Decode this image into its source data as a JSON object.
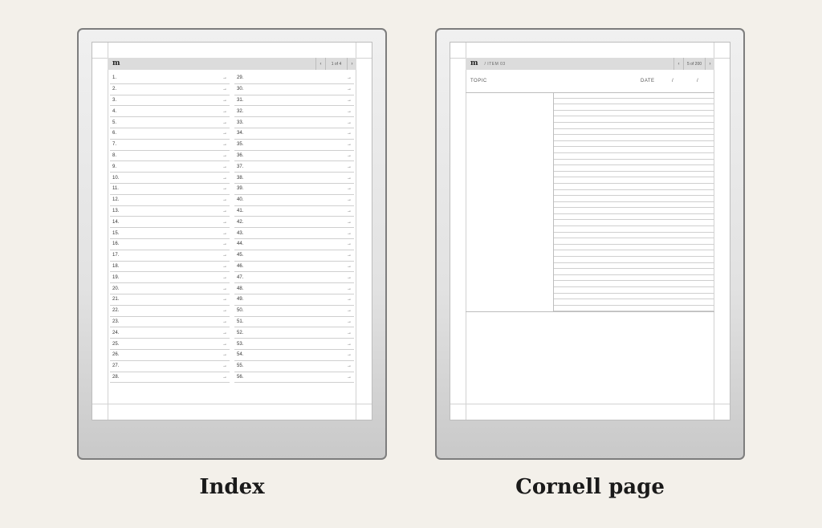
{
  "index_device": {
    "logo": "m",
    "pager": {
      "prev": "‹",
      "count": "1 of 4",
      "next": "›"
    },
    "left_entries": [
      "1.",
      "2.",
      "3.",
      "4.",
      "5.",
      "6.",
      "7.",
      "8.",
      "9.",
      "10.",
      "11.",
      "12.",
      "13.",
      "14.",
      "15.",
      "16.",
      "17.",
      "18.",
      "19.",
      "20.",
      "21.",
      "22.",
      "23.",
      "24.",
      "25.",
      "26.",
      "27.",
      "28."
    ],
    "right_entries": [
      "29.",
      "30.",
      "31.",
      "32.",
      "33.",
      "34.",
      "35.",
      "36.",
      "37.",
      "38.",
      "39.",
      "40.",
      "41.",
      "42.",
      "43.",
      "44.",
      "45.",
      "46.",
      "47.",
      "48.",
      "49.",
      "50.",
      "51.",
      "52.",
      "53.",
      "54.",
      "55.",
      "56."
    ],
    "arrow": "→",
    "caption": "Index"
  },
  "cornell_device": {
    "logo": "m",
    "breadcrumb": "/ ITEM 03",
    "pager": {
      "prev": "‹",
      "count": "5 of 200",
      "next": "›"
    },
    "topic_label": "TOPIC",
    "date_label": "DATE",
    "date_separator": "/",
    "note_line_count": 36,
    "caption": "Cornell page"
  }
}
